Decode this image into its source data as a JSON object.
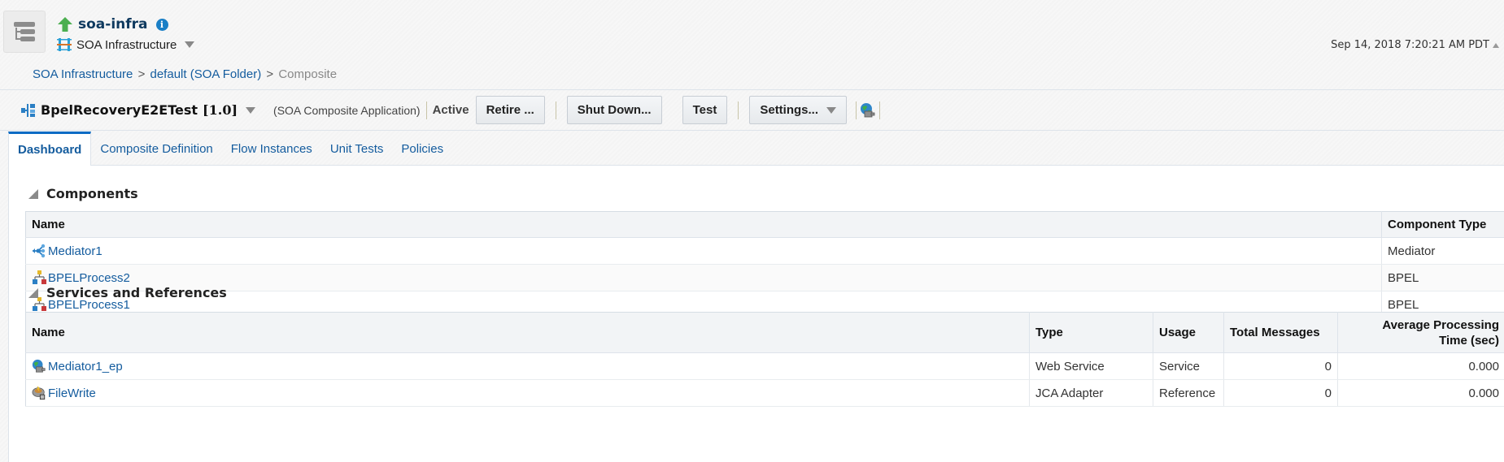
{
  "header": {
    "target_name": "soa-infra",
    "target_type": "SOA Infrastructure",
    "timestamp": "Sep 14, 2018 7:20:21 AM PDT",
    "status_color": "#4caf50"
  },
  "breadcrumb": {
    "items": [
      "SOA Infrastructure",
      "default (SOA Folder)"
    ],
    "separator": ">",
    "current": "Composite"
  },
  "composite": {
    "name": "BpelRecoveryE2ETest",
    "version": "[1.0]",
    "kind": "(SOA Composite Application)",
    "status": "Active",
    "buttons": {
      "retire": "Retire ...",
      "shutdown": "Shut Down...",
      "test": "Test",
      "settings": "Settings..."
    }
  },
  "tabs": [
    {
      "label": "Dashboard",
      "active": true
    },
    {
      "label": "Composite Definition",
      "active": false
    },
    {
      "label": "Flow Instances",
      "active": false
    },
    {
      "label": "Unit Tests",
      "active": false
    },
    {
      "label": "Policies",
      "active": false
    }
  ],
  "components": {
    "title": "Components",
    "columns": [
      "Name",
      "Component Type"
    ],
    "rows": [
      {
        "name": "Mediator1",
        "icon": "mediator-icon",
        "type": "Mediator"
      },
      {
        "name": "BPELProcess2",
        "icon": "bpel-process-icon",
        "type": "BPEL"
      },
      {
        "name": "BPELProcess1",
        "icon": "bpel-process-icon",
        "type": "BPEL"
      }
    ]
  },
  "services": {
    "title": "Services and References",
    "columns": [
      "Name",
      "Type",
      "Usage",
      "Total Messages",
      "Average Processing Time (sec)"
    ],
    "col_avg_line1": "Average Processing",
    "col_avg_line2": "Time (sec)",
    "rows": [
      {
        "name": "Mediator1_ep",
        "icon": "web-service-icon",
        "type": "Web Service",
        "usage": "Service",
        "total": "0",
        "avg": "0.000"
      },
      {
        "name": "FileWrite",
        "icon": "jca-adapter-icon",
        "type": "JCA Adapter",
        "usage": "Reference",
        "total": "0",
        "avg": "0.000"
      }
    ]
  }
}
